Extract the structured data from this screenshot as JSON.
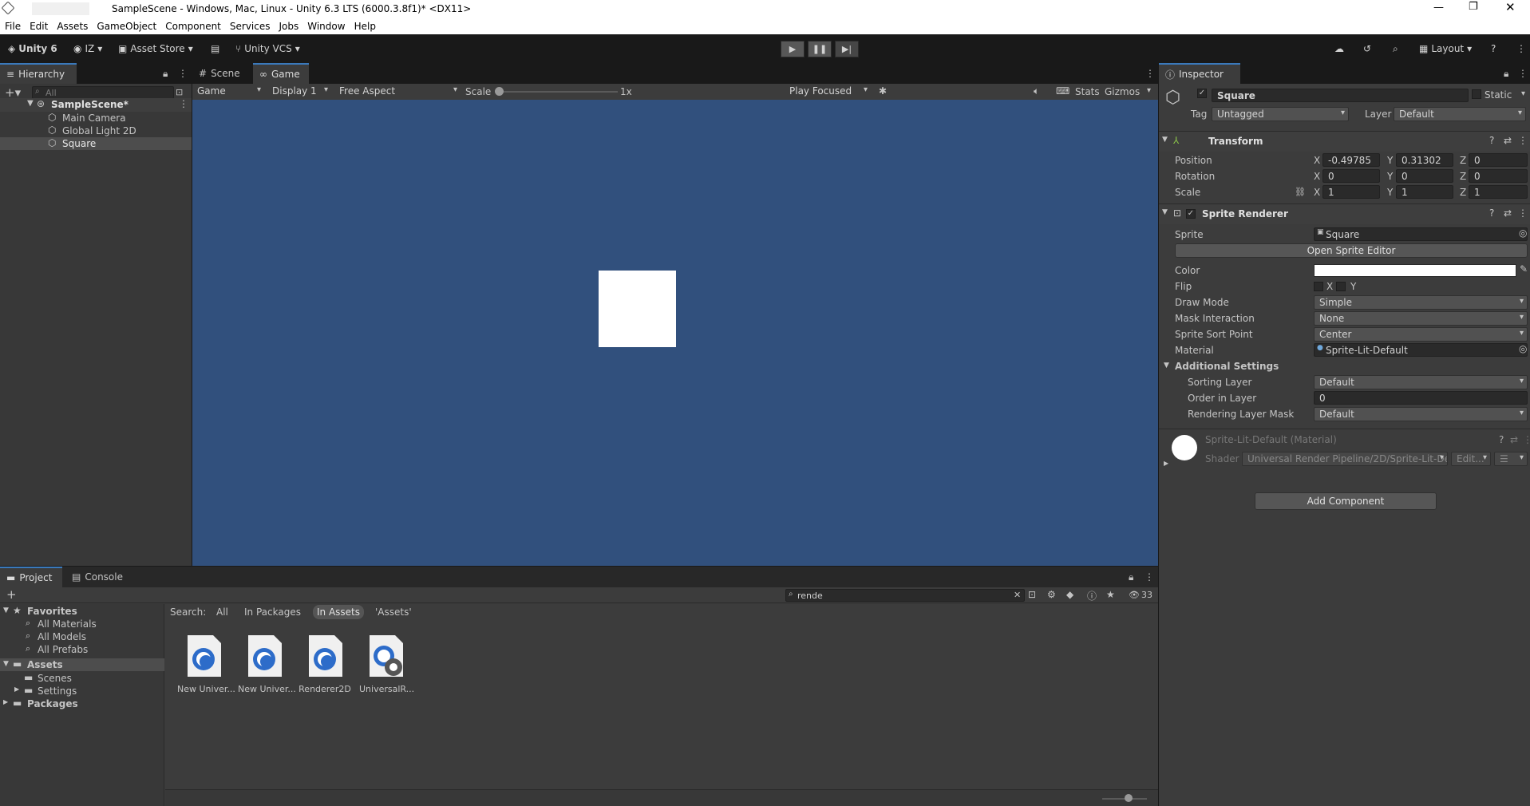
{
  "window": {
    "title": "SampleScene - Windows, Mac, Linux - Unity 6.3 LTS (6000.3.8f1)* <DX11>"
  },
  "menu": [
    "File",
    "Edit",
    "Assets",
    "GameObject",
    "Component",
    "Services",
    "Jobs",
    "Window",
    "Help"
  ],
  "toolbar": {
    "unity": "Unity 6",
    "account": "IZ",
    "store": "Asset Store",
    "vcs": "Unity VCS",
    "layout": "Layout"
  },
  "hierarchy": {
    "tab": "Hierarchy",
    "search": "All",
    "scene": "SampleScene*",
    "items": [
      "Main Camera",
      "Global Light 2D",
      "Square"
    ]
  },
  "gameview": {
    "tabs": [
      "Scene",
      "Game"
    ],
    "mode": "Game",
    "display": "Display 1",
    "aspect": "Free Aspect",
    "scale_label": "Scale",
    "scale_value": "1x",
    "play_focused": "Play Focused",
    "stats": "Stats",
    "gizmos": "Gizmos",
    "bg": "#31507d"
  },
  "inspector": {
    "tab": "Inspector",
    "name": "Square",
    "static": "Static",
    "tag_label": "Tag",
    "tag": "Untagged",
    "layer_label": "Layer",
    "layer": "Default",
    "transform": {
      "title": "Transform",
      "position": "Position",
      "rotation": "Rotation",
      "scale": "Scale",
      "px": "-0.49785",
      "py": "0.31302",
      "pz": "0",
      "rx": "0",
      "ry": "0",
      "rz": "0",
      "sx": "1",
      "sy": "1",
      "sz": "1",
      "x": "X",
      "y": "Y",
      "z": "Z"
    },
    "sprite_renderer": {
      "title": "Sprite Renderer",
      "sprite_label": "Sprite",
      "sprite": "Square",
      "open_editor": "Open Sprite Editor",
      "color": "Color",
      "flip": "Flip",
      "flip_x": "X",
      "flip_y": "Y",
      "draw_mode_label": "Draw Mode",
      "draw_mode": "Simple",
      "mask_label": "Mask Interaction",
      "mask": "None",
      "sort_point_label": "Sprite Sort Point",
      "sort_point": "Center",
      "material_label": "Material",
      "material": "Sprite-Lit-Default",
      "additional": "Additional Settings",
      "sorting_layer_label": "Sorting Layer",
      "sorting_layer": "Default",
      "order_label": "Order in Layer",
      "order": "0",
      "rlm_label": "Rendering Layer Mask",
      "rlm": "Default"
    },
    "material": {
      "title": "Sprite-Lit-Default (Material)",
      "shader_label": "Shader",
      "shader": "Universal Render Pipeline/2D/Sprite-Lit-Def",
      "edit": "Edit..."
    },
    "add_component": "Add Component"
  },
  "project": {
    "tabs": [
      "Project",
      "Console"
    ],
    "search": "rende",
    "count": "33",
    "search_label": "Search:",
    "filters": [
      "All",
      "In Packages",
      "In Assets",
      "'Assets'"
    ],
    "tree": {
      "favorites": "Favorites",
      "fav_items": [
        "All Materials",
        "All Models",
        "All Prefabs"
      ],
      "assets": "Assets",
      "asset_items": [
        "Scenes",
        "Settings"
      ],
      "packages": "Packages"
    },
    "assets": [
      "New Univer...",
      "New Univer...",
      "Renderer2D",
      "UniversalR..."
    ]
  }
}
